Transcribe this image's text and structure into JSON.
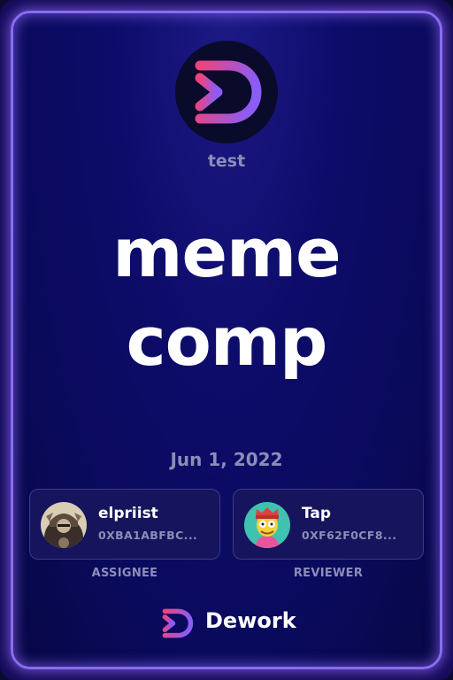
{
  "organization": {
    "name": "test"
  },
  "task": {
    "title_line1": "meme",
    "title_line2": "comp",
    "date": "Jun 1, 2022"
  },
  "assignee": {
    "name": "elpriist",
    "address": "0XBA1ABFBC...",
    "role_label": "ASSIGNEE"
  },
  "reviewer": {
    "name": "Tap",
    "address": "0XF62F0CF8...",
    "role_label": "REVIEWER"
  },
  "brand": {
    "name": "Dework"
  },
  "colors": {
    "accent_border": "#8a6cf2",
    "logo_gradient_start": "#e8427e",
    "logo_gradient_end": "#8b5cf6",
    "muted_text": "#8c8db8"
  },
  "icons": {
    "org_logo": "dework-d-logo-icon",
    "brand_logo": "dework-d-logo-icon"
  }
}
